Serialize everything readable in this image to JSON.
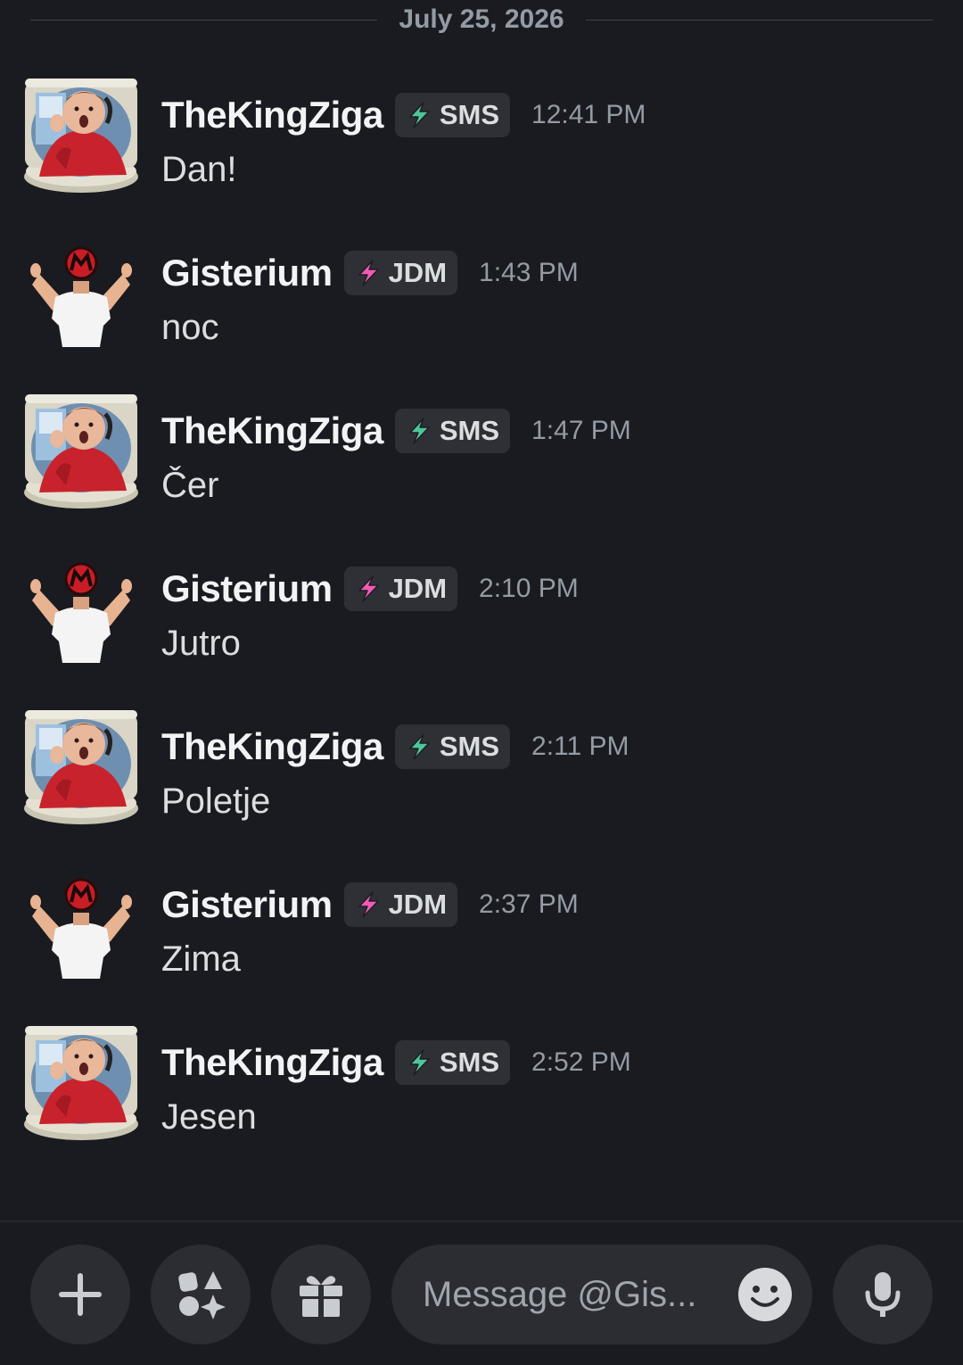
{
  "date_divider": "July 25, 2026",
  "messages": [
    {
      "author": "TheKingZiga",
      "tag": "SMS",
      "tag_color": "#4fc59b",
      "time": "12:41 PM",
      "text": "Dan!",
      "avatar": "toilet-avatar"
    },
    {
      "author": "Gisterium",
      "tag": "JDM",
      "tag_color": "#f25bb4",
      "time": "1:43 PM",
      "text": "noc",
      "avatar": "flex-avatar"
    },
    {
      "author": "TheKingZiga",
      "tag": "SMS",
      "tag_color": "#4fc59b",
      "time": "1:47 PM",
      "text": "Čer",
      "avatar": "toilet-avatar"
    },
    {
      "author": "Gisterium",
      "tag": "JDM",
      "tag_color": "#f25bb4",
      "time": "2:10 PM",
      "text": "Jutro",
      "avatar": "flex-avatar"
    },
    {
      "author": "TheKingZiga",
      "tag": "SMS",
      "tag_color": "#4fc59b",
      "time": "2:11 PM",
      "text": "Poletje",
      "avatar": "toilet-avatar"
    },
    {
      "author": "Gisterium",
      "tag": "JDM",
      "tag_color": "#f25bb4",
      "time": "2:37 PM",
      "text": "Zima",
      "avatar": "flex-avatar"
    },
    {
      "author": "TheKingZiga",
      "tag": "SMS",
      "tag_color": "#4fc59b",
      "time": "2:52 PM",
      "text": "Jesen",
      "avatar": "toilet-avatar"
    }
  ],
  "composer": {
    "placeholder": "Message @Gis...",
    "buttons": [
      "plus-icon",
      "apps-icon",
      "gift-icon",
      "emoji-icon",
      "mic-icon"
    ]
  },
  "colors": {
    "background": "#1a1b20",
    "button_bg": "#2b2d33",
    "sms_accent": "#4fc59b",
    "jdm_accent": "#f25bb4"
  }
}
